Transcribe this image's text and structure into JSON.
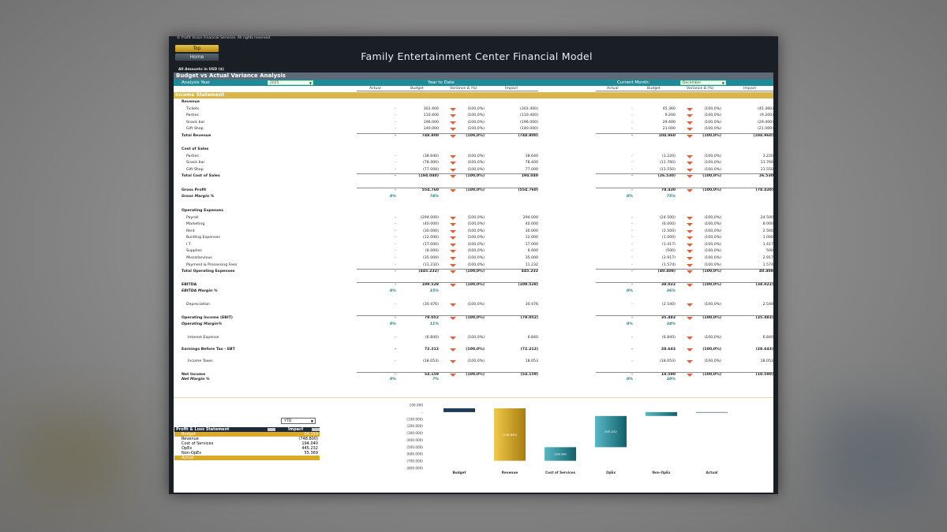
{
  "copyright": "© Profit Vision Financial Services. All rights reserved.",
  "nav": {
    "top_label": "Top",
    "home_label": "Home"
  },
  "model_title": "Family Entertainment Center Financial Model",
  "amounts_note": "All Amounts in  USD ($)",
  "section_title": "Budget vs Actual Variance Analysis",
  "analysis_year_label": "Analysis Year",
  "analysis_year_value": "2025",
  "ytd_label": "Year to Date",
  "current_month_label": "Current Month:",
  "current_month_value": "December",
  "columns": {
    "actual": "Actual",
    "budget": "Budget",
    "variance": "Variance Δ  (%)",
    "impact": "Impact"
  },
  "income_statement_label": "Income Statement",
  "colors": {
    "gold": "#d9b54a",
    "teal": "#1e8c98",
    "navy": "#1e2a38",
    "arrow": "#e0603a"
  },
  "rows": [
    {
      "label": "Revenue",
      "style": "head",
      "y": 0
    },
    {
      "label": "Tickets",
      "style": "ind",
      "ytd_actual": "-",
      "ytd_budget": "302.400",
      "ytd_var": "(100,0%)",
      "ytd_impact": "(302.400)",
      "m_actual": "-",
      "m_budget": "45.360",
      "m_var": "(100,0%)",
      "m_impact": "(45.360)"
    },
    {
      "label": "Parties",
      "style": "ind",
      "ytd_actual": "-",
      "ytd_budget": "110.400",
      "ytd_var": "(100,0%)",
      "ytd_impact": "(110.400)",
      "m_actual": "-",
      "m_budget": "9.200",
      "m_var": "(100,0%)",
      "m_impact": "(9.200)"
    },
    {
      "label": "Snack bar",
      "style": "ind",
      "ytd_actual": "-",
      "ytd_budget": "196.000",
      "ytd_var": "(100,0%)",
      "ytd_impact": "(196.000)",
      "m_actual": "-",
      "m_budget": "29.400",
      "m_var": "(100,0%)",
      "m_impact": "(29.400)"
    },
    {
      "label": "Gift Shop",
      "style": "ind",
      "ytd_actual": "-",
      "ytd_budget": "140.000",
      "ytd_var": "(100,0%)",
      "ytd_impact": "(140.000)",
      "m_actual": "-",
      "m_budget": "21.000",
      "m_var": "(100,0%)",
      "m_impact": "(21.000)"
    },
    {
      "label": "Total Revenue",
      "style": "b",
      "ytd_actual": "-",
      "ytd_budget": "748.800",
      "ytd_var": "(100,0%)",
      "ytd_impact": "(748.800)",
      "m_actual": "-",
      "m_budget": "104.960",
      "m_var": "(100,0%)",
      "m_impact": "(104.960)"
    },
    {
      "label": "Cost of Sales",
      "style": "head"
    },
    {
      "label": "Parties",
      "style": "ind",
      "ytd_actual": "-",
      "ytd_budget": "(38.640)",
      "ytd_var": "(100,0%)",
      "ytd_impact": "38.640",
      "m_actual": "-",
      "m_budget": "(3.220)",
      "m_var": "(100,0%)",
      "m_impact": "3.220"
    },
    {
      "label": "Snack bar",
      "style": "ind",
      "ytd_actual": "-",
      "ytd_budget": "(78.400)",
      "ytd_var": "(100,0%)",
      "ytd_impact": "78.400",
      "m_actual": "-",
      "m_budget": "(11.760)",
      "m_var": "(100,0%)",
      "m_impact": "11.760"
    },
    {
      "label": "Gift Shop",
      "style": "ind",
      "ytd_actual": "-",
      "ytd_budget": "(77.000)",
      "ytd_var": "(100,0%)",
      "ytd_impact": "77.000",
      "m_actual": "-",
      "m_budget": "(11.550)",
      "m_var": "(100,0%)",
      "m_impact": "11.550"
    },
    {
      "label": "Total Cost of Sales",
      "style": "b",
      "ytd_actual": "-",
      "ytd_budget": "(194.040)",
      "ytd_var": "(100,0%)",
      "ytd_impact": "194.040",
      "m_actual": "-",
      "m_budget": "(26.530)",
      "m_var": "(100,0%)",
      "m_impact": "26.530"
    },
    {
      "label": "Gross Profit",
      "style": "b",
      "ytd_actual": "-",
      "ytd_budget": "554.760",
      "ytd_var": "(100,0%)",
      "ytd_impact": "(554.760)",
      "m_actual": "-",
      "m_budget": "78.430",
      "m_var": "(100,0%)",
      "m_impact": "(78.430)"
    },
    {
      "label": "Gross Margin %",
      "style": "it",
      "ytd_actual": "0%",
      "ytd_budget": "74%",
      "m_actual": "0%",
      "m_budget": "75%"
    },
    {
      "label": "Operating Expenses",
      "style": "head"
    },
    {
      "label": "Payroll",
      "style": "ind",
      "ytd_actual": "-",
      "ytd_budget": "(294.000)",
      "ytd_var": "(100,0%)",
      "ytd_impact": "294.000",
      "m_actual": "-",
      "m_budget": "(24.500)",
      "m_var": "(100,0%)",
      "m_impact": "24.500"
    },
    {
      "label": "Marketing",
      "style": "ind",
      "ytd_actual": "-",
      "ytd_budget": "(40.000)",
      "ytd_var": "(100,0%)",
      "ytd_impact": "40.000",
      "m_actual": "-",
      "m_budget": "(6.000)",
      "m_var": "(100,0%)",
      "m_impact": "6.000"
    },
    {
      "label": "Rent",
      "style": "ind",
      "ytd_actual": "-",
      "ytd_budget": "(30.000)",
      "ytd_var": "(100,0%)",
      "ytd_impact": "30.000",
      "m_actual": "-",
      "m_budget": "(2.500)",
      "m_var": "(100,0%)",
      "m_impact": "2.500"
    },
    {
      "label": "Building Expenses",
      "style": "ind",
      "ytd_actual": "-",
      "ytd_budget": "(12.000)",
      "ytd_var": "(100,0%)",
      "ytd_impact": "12.000",
      "m_actual": "-",
      "m_budget": "(1.000)",
      "m_var": "(100,0%)",
      "m_impact": "1.000"
    },
    {
      "label": "I.T.",
      "style": "ind",
      "ytd_actual": "-",
      "ytd_budget": "(17.000)",
      "ytd_var": "(100,0%)",
      "ytd_impact": "17.000",
      "m_actual": "-",
      "m_budget": "(1.417)",
      "m_var": "(100,0%)",
      "m_impact": "1.417"
    },
    {
      "label": "Supplies",
      "style": "ind",
      "ytd_actual": "-",
      "ytd_budget": "(6.000)",
      "ytd_var": "(100,0%)",
      "ytd_impact": "6.000",
      "m_actual": "-",
      "m_budget": "(500)",
      "m_var": "(100,0%)",
      "m_impact": "500"
    },
    {
      "label": "Miscellaneous",
      "style": "ind",
      "ytd_actual": "-",
      "ytd_budget": "(35.000)",
      "ytd_var": "(100,0%)",
      "ytd_impact": "35.000",
      "m_actual": "-",
      "m_budget": "(2.917)",
      "m_var": "(100,0%)",
      "m_impact": "2.917"
    },
    {
      "label": "Payment & Processing Fees",
      "style": "ind",
      "ytd_actual": "-",
      "ytd_budget": "(11.232)",
      "ytd_var": "(100,0%)",
      "ytd_impact": "11.232",
      "m_actual": "-",
      "m_budget": "(1.574)",
      "m_var": "(100,0%)",
      "m_impact": "1.574"
    },
    {
      "label": "Total Operating Expenses",
      "style": "b",
      "ytd_actual": "-",
      "ytd_budget": "(445.232)",
      "ytd_var": "(100,0%)",
      "ytd_impact": "445.232",
      "m_actual": "-",
      "m_budget": "(40.408)",
      "m_var": "(100,0%)",
      "m_impact": "40.408"
    },
    {
      "label": "EBITDA",
      "style": "b",
      "ytd_actual": "-",
      "ytd_budget": "109.528",
      "ytd_var": "(100,0%)",
      "ytd_impact": "(109.528)",
      "m_actual": "-",
      "m_budget": "38.022",
      "m_var": "(100,0%)",
      "m_impact": "(38.022)"
    },
    {
      "label": "EBITDA Margin %",
      "style": "it",
      "ytd_actual": "0%",
      "ytd_budget": "15%",
      "m_actual": "0%",
      "m_budget": "36%"
    },
    {
      "label": "Depreciation",
      "style": "ind",
      "ytd_actual": "-",
      "ytd_budget": "(30.476)",
      "ytd_var": "(100,0%)",
      "ytd_impact": "30.476",
      "m_actual": "-",
      "m_budget": "(2.540)",
      "m_var": "(100,0%)",
      "m_impact": "2.540"
    },
    {
      "label": "Operating Income (EBIT)",
      "style": "b",
      "ytd_actual": "-",
      "ytd_budget": "79.052",
      "ytd_var": "(100,0%)",
      "ytd_impact": "(79.052)",
      "m_actual": "-",
      "m_budget": "35.483",
      "m_var": "(100,0%)",
      "m_impact": "(35.483)"
    },
    {
      "label": "Operating Margin%",
      "style": "it",
      "ytd_actual": "0%",
      "ytd_budget": "11%",
      "m_actual": "0%",
      "m_budget": "34%"
    },
    {
      "label": "Interest Expense",
      "style": "ind2",
      "ytd_actual": "-",
      "ytd_budget": "(6.840)",
      "ytd_var": "(100,0%)",
      "ytd_impact": "6.840",
      "m_actual": "-",
      "m_budget": "(6.840)",
      "m_var": "(100,0%)",
      "m_impact": "6.840"
    },
    {
      "label": "Earnings Before Tax - EBT",
      "style": "b",
      "ytd_actual": "-",
      "ytd_budget": "72.212",
      "ytd_var": "(100,0%)",
      "ytd_impact": "(72.212)",
      "m_actual": "-",
      "m_budget": "28.643",
      "m_var": "(100,0%)",
      "m_impact": "(28.643)"
    },
    {
      "label": "Income Taxes",
      "style": "ind2",
      "ytd_actual": "-",
      "ytd_budget": "(18.053)",
      "ytd_var": "(100,0%)",
      "ytd_impact": "18.053",
      "m_actual": "-",
      "m_budget": "(18.053)",
      "m_var": "(100,0%)",
      "m_impact": "18.053"
    },
    {
      "label": "Net Income",
      "style": "b",
      "ytd_actual": "-",
      "ytd_budget": "54.159",
      "ytd_var": "(100,0%)",
      "ytd_impact": "(54.159)",
      "m_actual": "-",
      "m_budget": "10.590",
      "m_var": "(100,0%)",
      "m_impact": "(10.590)"
    },
    {
      "label": "Net Margin %",
      "style": "it",
      "ytd_actual": "0%",
      "ytd_budget": "7%",
      "m_actual": "0%",
      "m_budget": "10%"
    }
  ],
  "bottom": {
    "period_value": "YTD",
    "pl_header": {
      "label": "Profit & Loss Statement",
      "impact": "Impact"
    },
    "pl_rows": [
      {
        "label": "Budget",
        "value": "54.159",
        "style": "gold"
      },
      {
        "label": "Revenue",
        "value": "(748.800)"
      },
      {
        "label": "Cost of Services",
        "value": "194.040"
      },
      {
        "label": "OpEx",
        "value": "445.232"
      },
      {
        "label": "Non-OpEx",
        "value": "55.369"
      },
      {
        "label": "Actual",
        "value": "",
        "style": "gold"
      }
    ]
  },
  "chart_data": {
    "type": "bar",
    "categories": [
      "Budget",
      "Revenue",
      "Cost of Services",
      "OpEx",
      "Non-OpEx",
      "Actual"
    ],
    "values": [
      54159,
      -748800,
      194040,
      445232,
      55369,
      0
    ],
    "data_labels": [
      "",
      "(748.800)",
      "194.040",
      "445.232",
      "",
      ""
    ],
    "y_ticks": [
      "100.000",
      "-",
      "(100.000)",
      "(200.000)",
      "(300.000)",
      "(400.000)",
      "(500.000)",
      "(600.000)",
      "(700.000)",
      "(800.000)"
    ],
    "ylim": [
      -800000,
      100000
    ],
    "colors": [
      "#1e3a5a",
      "#d8a92a",
      "#1e8c98",
      "#1e8c98",
      "#1e8c98",
      "#1e3a5a"
    ]
  }
}
